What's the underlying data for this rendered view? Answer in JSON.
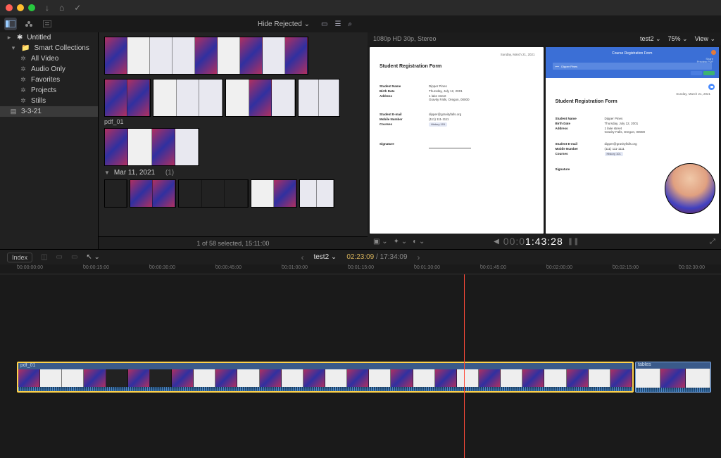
{
  "titlebar": {
    "icons": [
      "download",
      "key",
      "check"
    ]
  },
  "toolbar": {
    "hide_rejected": "Hide Rejected",
    "video_format": "1080p HD 30p, Stereo",
    "project_name": "test2",
    "zoom": "75%",
    "view": "View"
  },
  "sidebar": {
    "library": "Untitled",
    "smart": "Smart Collections",
    "items": [
      {
        "label": "All Video"
      },
      {
        "label": "Audio Only"
      },
      {
        "label": "Favorites"
      },
      {
        "label": "Projects"
      },
      {
        "label": "Stills"
      }
    ],
    "event": "3-3-21"
  },
  "browser": {
    "clip1_label": "pdf_01",
    "section": "Mar 11, 2021",
    "section_count": "(1)",
    "footer": "1 of 58 selected, 15:11:00"
  },
  "viewer": {
    "format": "1080p HD 30p, Stereo",
    "name": "test2",
    "zoom": "75%",
    "view": "View",
    "timecode_dim": "00:0",
    "timecode_hot": "1:43:28"
  },
  "form": {
    "title": "Student Registration Form",
    "date": "Sunday, March 21, 2021",
    "fields": {
      "name_l": "Student Name",
      "name_v": "Dipper Pines",
      "birth_l": "Birth Date",
      "birth_v": "Thursday, July 12, 2001",
      "addr_l": "Address",
      "addr_v1": "1 lake street",
      "addr_v2": "Gravity Falls, Oregon, 00000",
      "email_l": "Student E-mail",
      "email_v": "dipper@gravityfalls.org",
      "mobile_l": "Mobile Number",
      "mobile_v": "(111) 111-1111",
      "courses_l": "Courses",
      "courses_v": "History 101",
      "sig_l": "Signature"
    },
    "b_header": "Course Registration Form",
    "b_share": "Share",
    "b_preview": "Preview PDF"
  },
  "timeline": {
    "index": "Index",
    "project": "test2",
    "pos": "02:23:09",
    "dur": "17:34:09",
    "ruler": [
      "00:00:00:00",
      "00:00:15:00",
      "00:00:30:00",
      "00:00:45:00",
      "00:01:00:00",
      "00:01:15:00",
      "00:01:30:00",
      "00:01:45:00",
      "00:02:00:00",
      "00:02:15:00",
      "00:02:30:00"
    ],
    "clip1": "pdf_01",
    "clip2": "tables"
  }
}
